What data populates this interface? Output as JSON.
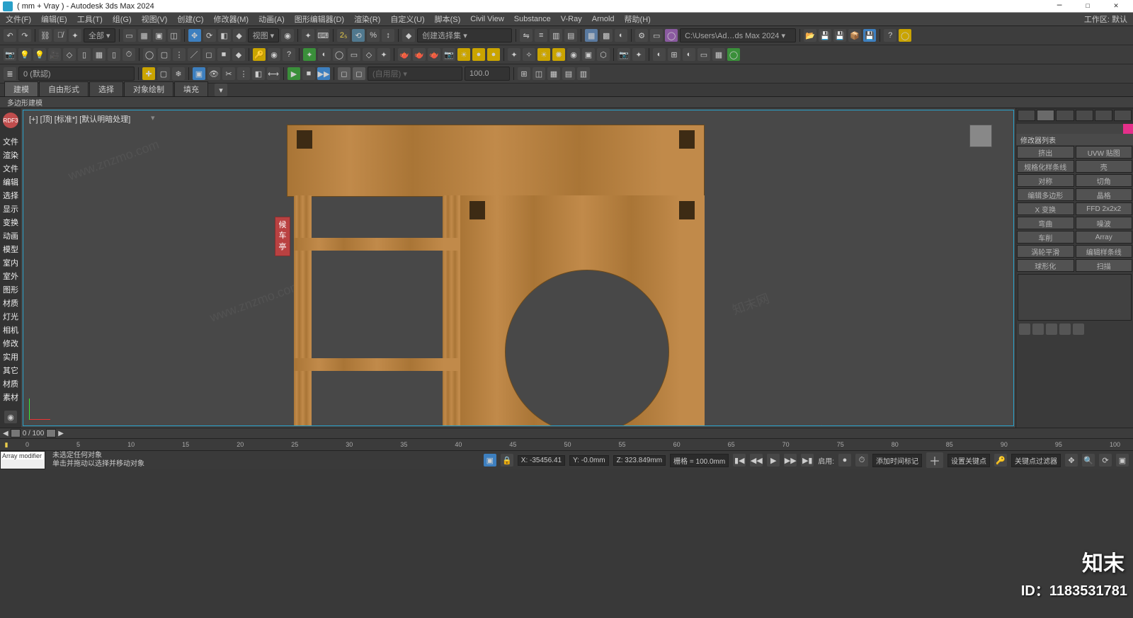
{
  "title": "( mm + Vray ) - Autodesk 3ds Max 2024",
  "workspace_label": "工作区: 默认",
  "menu": [
    "文件(F)",
    "编辑(E)",
    "工具(T)",
    "组(G)",
    "视图(V)",
    "创建(C)",
    "修改器(M)",
    "动画(A)",
    "图形编辑器(D)",
    "渲染(R)",
    "自定义(U)",
    "脚本(S)",
    "Civil View",
    "Substance",
    "V-Ray",
    "Arnold",
    "帮助(H)"
  ],
  "toolbar1": {
    "combo1": "全部 ▾",
    "view_combo": "视图 ▾",
    "selset_combo": "创建选择集 ▾",
    "path_combo": "C:\\Users\\Ad…ds Max 2024 ▾"
  },
  "toolbar3": {
    "layer_combo": "0 (默認)",
    "spin": "100.0"
  },
  "tabs": {
    "items": [
      "建模",
      "自由形式",
      "选择",
      "对象绘制",
      "填充"
    ],
    "active": 0,
    "subtab": "多边形建模"
  },
  "viewport": {
    "label": "[+] [顶] [标准*] [默认明暗处理]",
    "sign_text": "候车亭"
  },
  "left_circle": "RDF3",
  "left_labels": [
    "文件",
    "渲染",
    "文件",
    "编辑",
    "选择",
    "显示",
    "变换",
    "动画",
    "模型",
    "室内",
    "室外",
    "图形",
    "材质",
    "灯光",
    "相机",
    "修改",
    "实用",
    "其它",
    "材质",
    "素材"
  ],
  "right_panel": {
    "header": "修改器列表",
    "grid": [
      [
        "挤出",
        "UVW 贴图"
      ],
      [
        "规格化样条线",
        "壳"
      ],
      [
        "对称",
        "切角"
      ],
      [
        "编辑多边形",
        "晶格"
      ],
      [
        "X 变换",
        "FFD 2x2x2"
      ],
      [
        "弯曲",
        "噪波"
      ],
      [
        "车削",
        "Array"
      ],
      [
        "涡轮平滑",
        "编辑样条线"
      ],
      [
        "球形化",
        "扫描"
      ]
    ]
  },
  "timeslider": {
    "frame": "0 / 100"
  },
  "timeline_ticks": [
    "0",
    "5",
    "10",
    "15",
    "20",
    "25",
    "30",
    "35",
    "40",
    "45",
    "50",
    "55",
    "60",
    "65",
    "70",
    "75",
    "80",
    "85",
    "90",
    "95",
    "100"
  ],
  "status": {
    "swatch_top": "",
    "swatch_bottom": "Array modifier",
    "line1": "未选定任何对象",
    "line2": "单击并拖动以选择并移动对象",
    "enable_label": "启用:",
    "x": "X: -35456.41",
    "y": "Y: -0.0mm",
    "z": "Z: 323.849mm",
    "grid": "栅格 = 100.0mm",
    "add_time_tag": "添加时间标记",
    "set_key": "设置关键点",
    "key_filter": "关键点过滤器"
  },
  "watermark": {
    "logo": "知末",
    "id": "ID：1183531781",
    "diag": "www.znzmo.com",
    "diag_cn": "知末网"
  }
}
